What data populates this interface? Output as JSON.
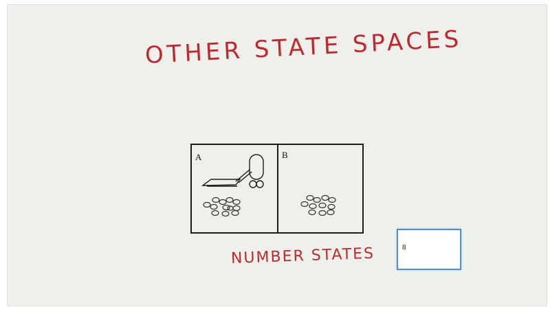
{
  "slide": {
    "title": "OTHER STATE SPACES",
    "question_label": "NUMBER STATES"
  },
  "diagram": {
    "room_a_label": "A",
    "room_b_label": "B"
  },
  "answer": {
    "value": "8"
  },
  "colors": {
    "marker_red": "#c0282e",
    "input_border": "#4a8fe0",
    "board_background": "#eef0ec"
  }
}
